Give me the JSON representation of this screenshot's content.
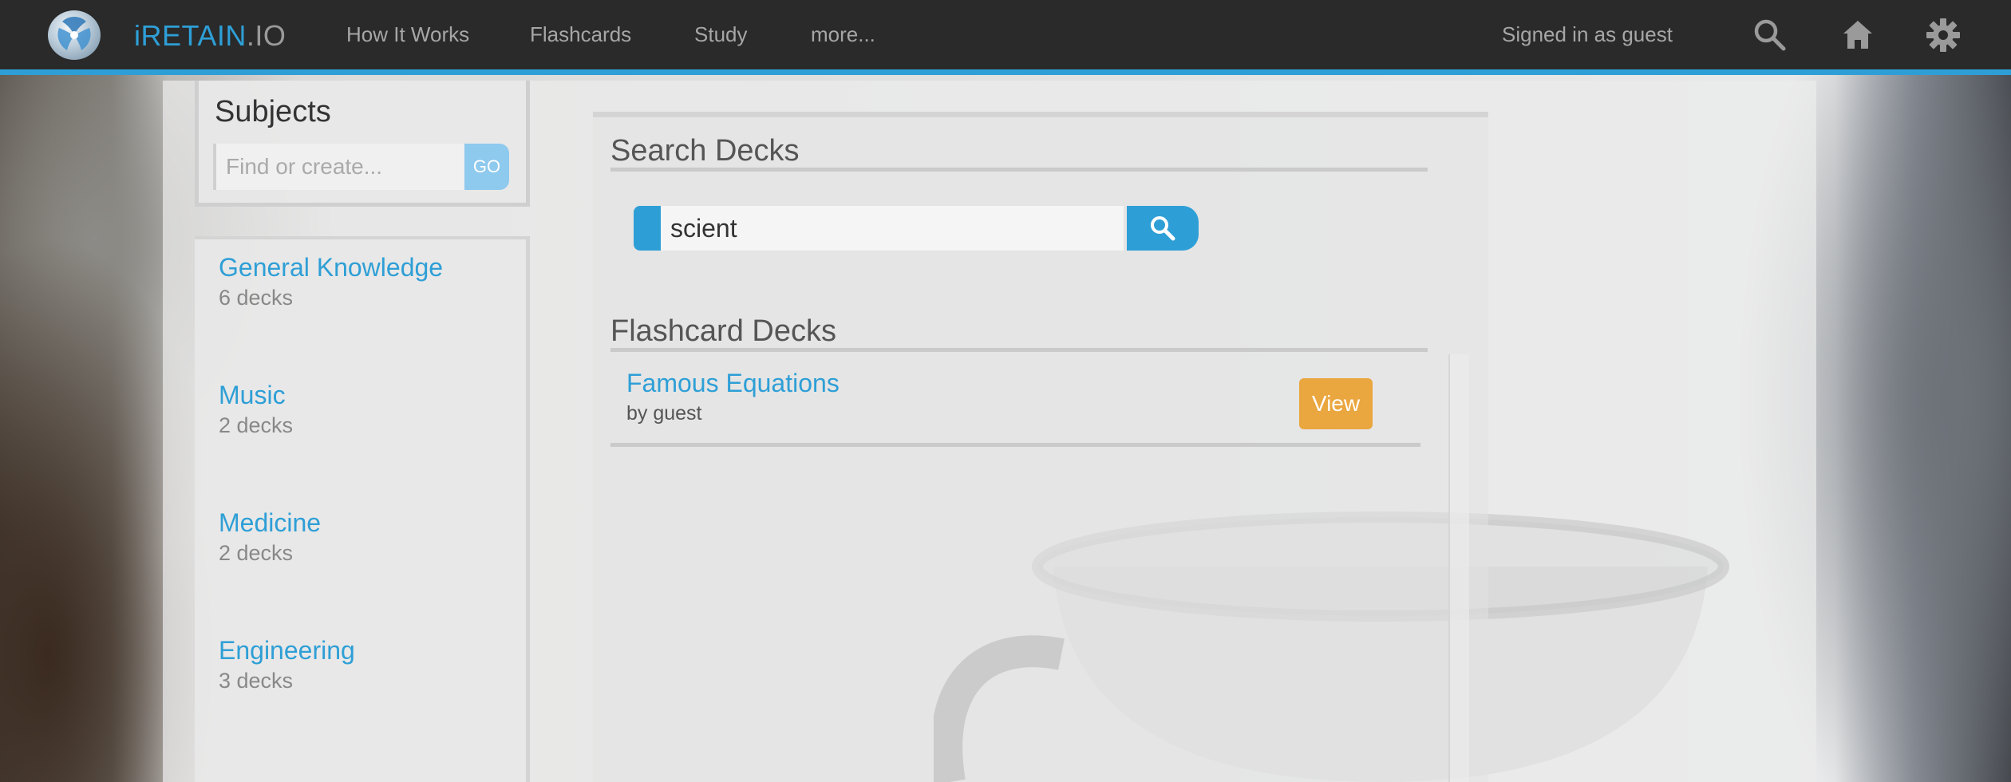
{
  "app": {
    "brand_part1": "iRETAIN",
    "brand_part2": ".IO"
  },
  "nav": {
    "items": [
      {
        "label": "How It Works"
      },
      {
        "label": "Flashcards"
      },
      {
        "label": "Study"
      },
      {
        "label": "more..."
      }
    ],
    "signed_in_text": "Signed in as guest",
    "icons": [
      "search-icon",
      "home-icon",
      "gear-icon"
    ]
  },
  "sidebar": {
    "title": "Subjects",
    "search_placeholder": "Find or create...",
    "go_label": "GO",
    "subjects": [
      {
        "name": "General Knowledge",
        "count": "6 decks"
      },
      {
        "name": "Music",
        "count": "2 decks"
      },
      {
        "name": "Medicine",
        "count": "2 decks"
      },
      {
        "name": "Engineering",
        "count": "3 decks"
      }
    ]
  },
  "search": {
    "title": "Search Decks",
    "query": "scient"
  },
  "results": {
    "title": "Flashcard Decks",
    "decks": [
      {
        "title": "Famous Equations",
        "author": "by guest",
        "action": "View"
      }
    ]
  },
  "colors": {
    "accent": "#2e9fd6",
    "view_button": "#eaa63f",
    "topbar": "#2a2a2a"
  }
}
